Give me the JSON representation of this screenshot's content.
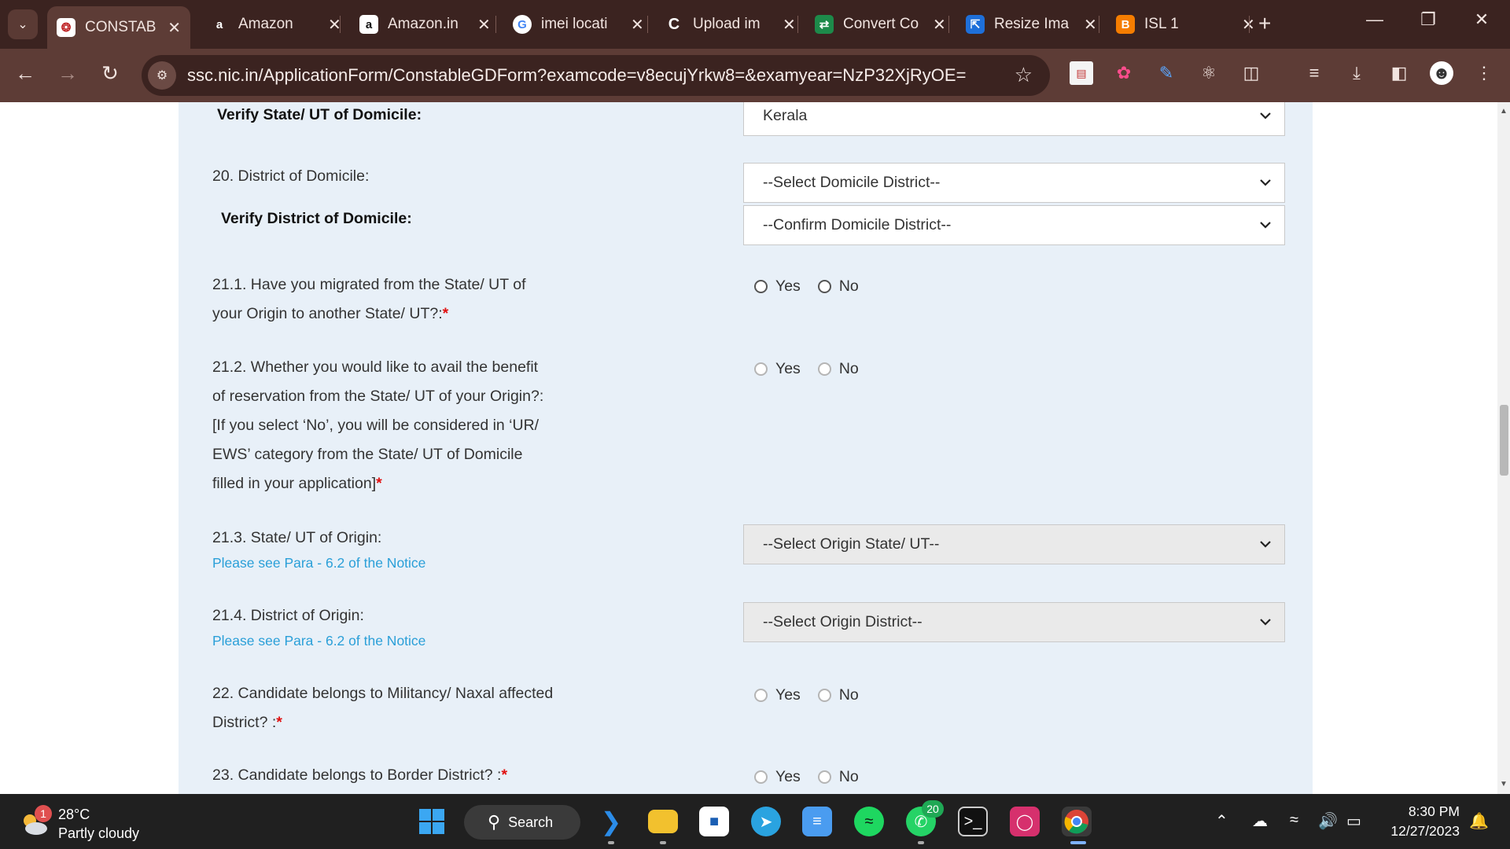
{
  "browser": {
    "tabs": [
      {
        "title": "CONSTABL",
        "favicon": "ssc-emblem-icon",
        "active": true
      },
      {
        "title": "Amazon",
        "favicon": "amazon-icon",
        "active": false
      },
      {
        "title": "Amazon.in",
        "favicon": "amazon-icon",
        "active": false
      },
      {
        "title": "imei locati",
        "favicon": "google-icon",
        "active": false
      },
      {
        "title": "Upload im",
        "favicon": "upload-c-icon",
        "active": false
      },
      {
        "title": "Convert Co",
        "favicon": "convert-icon",
        "active": false
      },
      {
        "title": "Resize Ima",
        "favicon": "resize-icon",
        "active": false
      },
      {
        "title": "ISL 1",
        "favicon": "blogger-icon",
        "active": false
      }
    ],
    "url": "ssc.nic.in/ApplicationForm/ConstableGDForm?examcode=v8ecujYrkw8=&examyear=NzP32XjRyOE="
  },
  "form": {
    "verify_state": {
      "label": "Verify State/ UT of Domicile:",
      "value": "Kerala"
    },
    "district_domicile": {
      "label": "20. District of Domicile:",
      "value": "--Select Domicile District--"
    },
    "verify_district": {
      "label": "Verify District of Domicile:",
      "value": "--Confirm Domicile District--"
    },
    "q21_1": {
      "label_line1": "21.1. Have you migrated from the State/ UT of",
      "label_line2": "your Origin to another State/ UT?:",
      "yes": "Yes",
      "no": "No"
    },
    "q21_2": {
      "line1": "21.2. Whether you would like to avail the benefit",
      "line2": "of reservation from the State/ UT of your Origin?:",
      "line3": "[If you select ‘No’, you will be considered in ‘UR/",
      "line4": "EWS’ category from the State/ UT of Domicile",
      "line5": "filled in your application]",
      "yes": "Yes",
      "no": "No"
    },
    "q21_3": {
      "label": "21.3. State/ UT of Origin:",
      "note": "Please see Para - 6.2 of the Notice",
      "value": "--Select Origin State/ UT--"
    },
    "q21_4": {
      "label": "21.4. District of Origin:",
      "note": "Please see Para - 6.2 of the Notice",
      "value": "--Select Origin District--"
    },
    "q22": {
      "line1": "22. Candidate belongs to Militancy/ Naxal affected",
      "line2": "District? :",
      "yes": "Yes",
      "no": "No"
    },
    "q23": {
      "label": "23. Candidate belongs to Border District? :",
      "yes": "Yes",
      "no": "No"
    },
    "required_mark": "*"
  },
  "taskbar": {
    "weather_temp": "28°C",
    "weather_desc": "Partly cloudy",
    "weather_badge": "1",
    "search_label": "Search",
    "whatsapp_badge": "20",
    "time": "8:30 PM",
    "date": "12/27/2023"
  }
}
